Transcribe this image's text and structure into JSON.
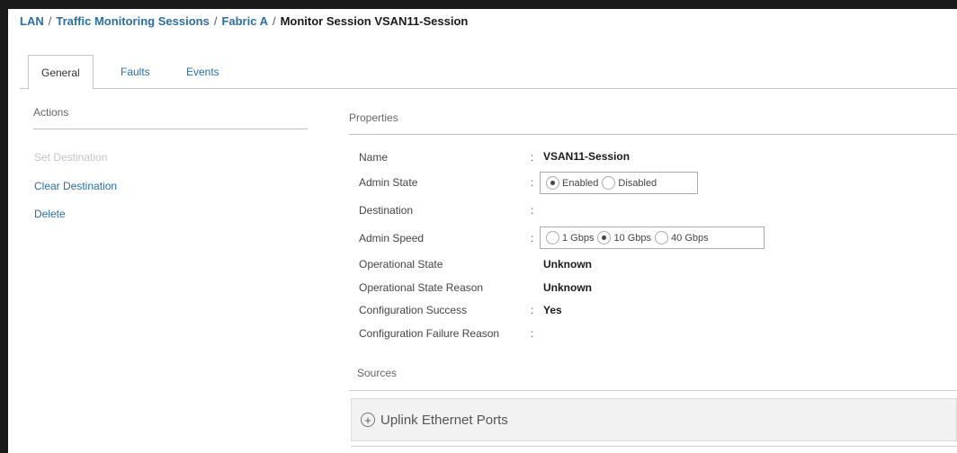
{
  "breadcrumb": {
    "items": [
      "LAN",
      "Traffic Monitoring Sessions",
      "Fabric A"
    ],
    "separator": "/",
    "current": "Monitor Session VSAN11-Session"
  },
  "tabs": [
    {
      "label": "General",
      "active": true
    },
    {
      "label": "Faults",
      "active": false
    },
    {
      "label": "Events",
      "active": false
    }
  ],
  "actions": {
    "title": "Actions",
    "items": [
      {
        "label": "Set Destination",
        "enabled": false
      },
      {
        "label": "Clear Destination",
        "enabled": true
      },
      {
        "label": "Delete",
        "enabled": true
      }
    ]
  },
  "properties": {
    "title": "Properties",
    "colon": ":",
    "name": {
      "label": "Name",
      "value": "VSAN11-Session"
    },
    "admin_state": {
      "label": "Admin State",
      "options": [
        "Enabled",
        "Disabled"
      ],
      "selected": "Enabled"
    },
    "destination": {
      "label": "Destination",
      "value": ""
    },
    "admin_speed": {
      "label": "Admin Speed",
      "options": [
        "1 Gbps",
        "10 Gbps",
        "40 Gbps"
      ],
      "selected": "10 Gbps"
    },
    "operational_state": {
      "label": "Operational State",
      "value": "Unknown"
    },
    "operational_state_reason": {
      "label": "Operational State Reason",
      "value": "Unknown"
    },
    "configuration_success": {
      "label": "Configuration Success",
      "value": "Yes"
    },
    "configuration_failure_reason": {
      "label": "Configuration Failure Reason",
      "value": ""
    }
  },
  "sources": {
    "title": "Sources",
    "panel_label": "Uplink Ethernet Ports",
    "panel_icon": "plus-circle-icon"
  },
  "colors": {
    "link": "#2a6ea8",
    "frame": "#1a1a1a"
  }
}
